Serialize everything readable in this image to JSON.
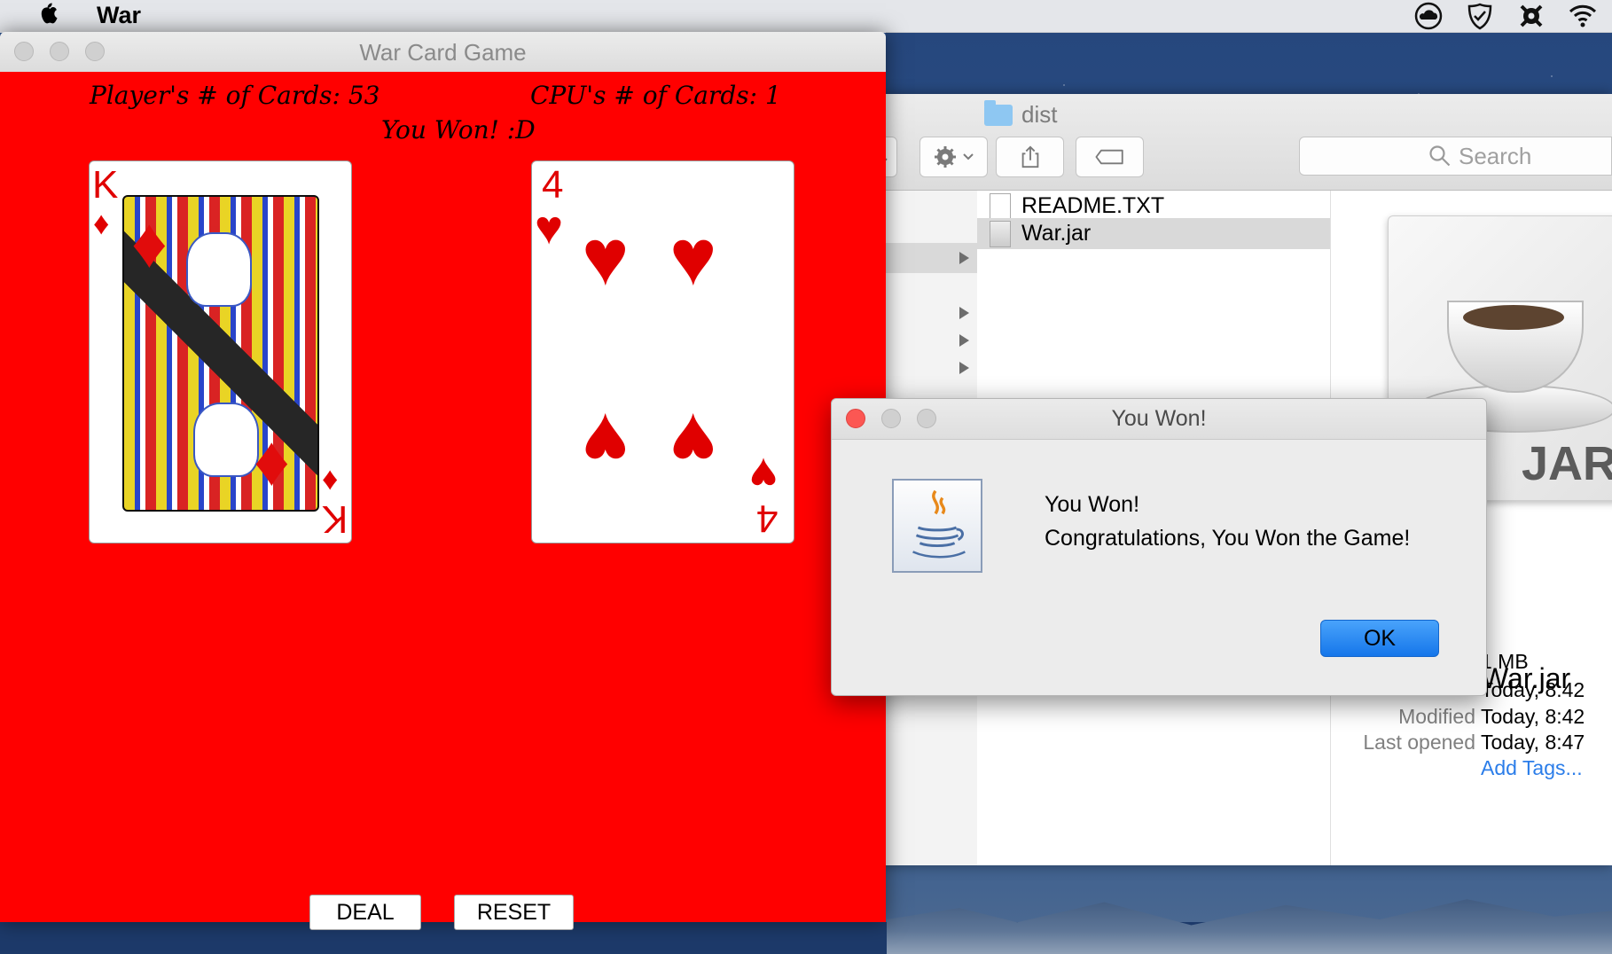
{
  "menubar": {
    "app_name": "War",
    "status_icons": [
      "cloud-icon",
      "checkmark-icon",
      "gear-badge-icon",
      "wifi-icon"
    ]
  },
  "war_window": {
    "title": "War Card Game",
    "player_cards_label": "Player's # of Cards: 53",
    "cpu_cards_label": "CPU's # of Cards: 1",
    "status_label": "You Won! :D",
    "player_card": {
      "rank": "K",
      "suit": "diamonds"
    },
    "cpu_card": {
      "rank": "4",
      "suit": "hearts"
    },
    "deal_label": "DEAL",
    "reset_label": "RESET",
    "background_color": "#ff0000"
  },
  "finder": {
    "title": "dist",
    "search_placeholder": "Search",
    "files": [
      {
        "name": "README.TXT",
        "icon": "text-file-icon"
      },
      {
        "name": "War.jar",
        "icon": "jar-file-icon"
      }
    ],
    "preview": {
      "icon_label": "JAR",
      "name": "War.jar",
      "size": "1 MB",
      "created": "Today, 8:42",
      "modified_label": "Modified",
      "modified": "Today, 8:42",
      "last_opened_label": "Last opened",
      "last_opened": "Today, 8:47",
      "add_tags": "Add Tags..."
    }
  },
  "dialog": {
    "title": "You Won!",
    "message_line1": "You Won!",
    "message_line2": "Congratulations, You Won the Game!",
    "ok_label": "OK"
  }
}
